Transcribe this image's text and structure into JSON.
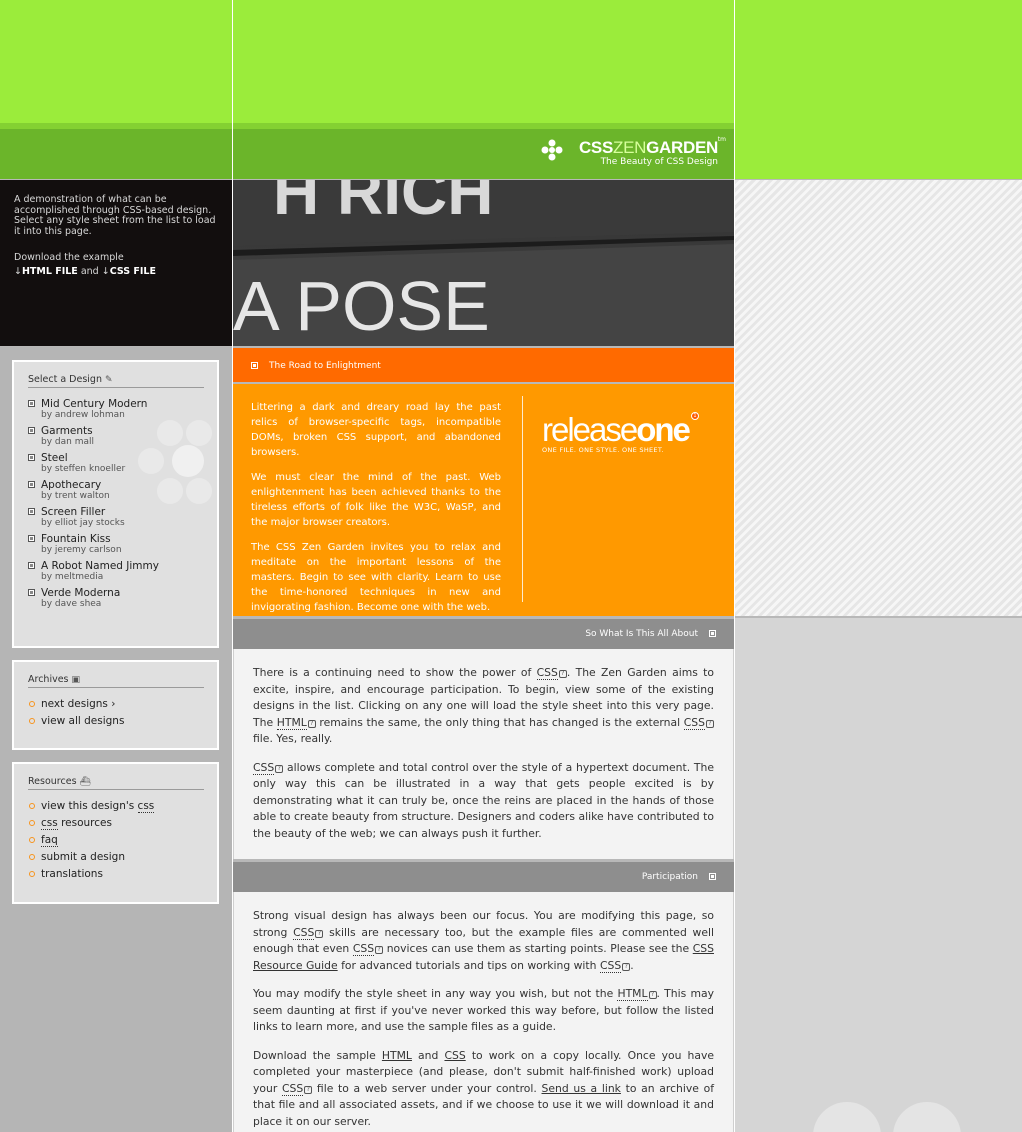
{
  "header": {
    "logo_css": "CSS",
    "logo_zen": "ZEN",
    "logo_garden": "GARDEN",
    "logo_tm": "tm",
    "tagline": "The Beauty of CSS Design"
  },
  "intro": {
    "summary": "A demonstration of what can be accomplished through CSS-based design. Select any style sheet from the list to load it into this page.",
    "download_prefix": "Download the example",
    "html_file": "HTML FILE",
    "and": "and",
    "css_file": "CSS FILE"
  },
  "photo": {
    "line1": "H RICH",
    "line2": "A POSE"
  },
  "sidebar": {
    "designs_title": "Select a Design",
    "by": "by",
    "designs": [
      {
        "name": "Mid Century Modern",
        "author": "andrew lohman"
      },
      {
        "name": "Garments",
        "author": "dan mall"
      },
      {
        "name": "Steel",
        "author": "steffen knoeller"
      },
      {
        "name": "Apothecary",
        "author": "trent walton"
      },
      {
        "name": "Screen Filler",
        "author": "elliot jay stocks"
      },
      {
        "name": "Fountain Kiss",
        "author": "jeremy carlson"
      },
      {
        "name": "A Robot Named Jimmy",
        "author": "meltmedia"
      },
      {
        "name": "Verde Moderna",
        "author": "dave shea"
      }
    ],
    "archives_title": "Archives",
    "archives": [
      "next designs ›",
      "view all designs"
    ],
    "resources_title": "Resources",
    "resources": [
      "view this design's",
      "css",
      "resources",
      "faq",
      "submit a design",
      "translations"
    ],
    "resources_css_abbr": "css"
  },
  "road": {
    "heading": "The Road to Enlightment",
    "p1": "Littering a dark and dreary road lay the past relics of browser-specific tags, incompatible DOMs, broken CSS support, and abandoned browsers.",
    "p2": "We must clear the mind of the past. Web enlightenment has been achieved thanks to the tireless efforts of folk like the W3C, WaSP, and the major browser creators.",
    "p3": "The CSS Zen Garden invites you to relax and meditate on the important lessons of the masters. Begin to see with clarity. Learn to use the time-honored techniques in new and invigorating fashion. Become one with the web.",
    "release_a": "release",
    "release_b": "one",
    "release_badge": "1",
    "release_sub": "ONE FILE. ONE STYLE. ONE SHEET."
  },
  "about": {
    "heading": "So What Is This All About",
    "p1_a": "There is a continuing need to show the power of",
    "css": "CSS",
    "html": "HTML",
    "p1_b": ". The Zen Garden aims to excite, inspire, and encourage participation. To begin, view some of the existing designs in the list. Clicking on any one will load the style sheet into this very page. The",
    "p1_c": "remains the same, the only thing that has changed is the external",
    "p1_d": "file. Yes, really.",
    "p2": "allows complete and total control over the style of a hypertext document. The only way this can be illustrated in a way that gets people excited is by demonstrating what it can truly be, once the reins are placed in the hands of those able to create beauty from structure. Designers and coders alike have contributed to the beauty of the web; we can always push it further."
  },
  "participation": {
    "heading": "Participation",
    "p1_a": "Strong visual design has always been our focus. You are modifying this page, so strong",
    "p1_b": "skills are necessary too, but the example files are commented well enough that even",
    "p1_c": "novices can use them as starting points. Please see the",
    "p1_link": "CSS Resource Guide",
    "p1_d": "for advanced tutorials and tips on working with",
    "p2_a": "You may modify the style sheet in any way you wish, but not the",
    "p2_b": ". This may seem daunting at first if you've never worked this way before, but follow the listed links to learn more, and use the sample files as a guide.",
    "p3_a": "Download the sample",
    "p3_html": "HTML",
    "p3_and": "and",
    "p3_css": "CSS",
    "p3_b": "to work on a copy locally. Once you have completed your masterpiece (and please, don't submit half-finished work) upload your",
    "p3_c": "file to a web server under your control.",
    "p3_link": "Send us a link",
    "p3_d": "to an archive of that file and all associated assets, and if we choose to use it we will download it and place it on our server."
  },
  "colors": {
    "green": "#9bec3b",
    "orange_dark": "#ff6a00",
    "orange": "#ff9900",
    "bullet": "#f7941d"
  }
}
